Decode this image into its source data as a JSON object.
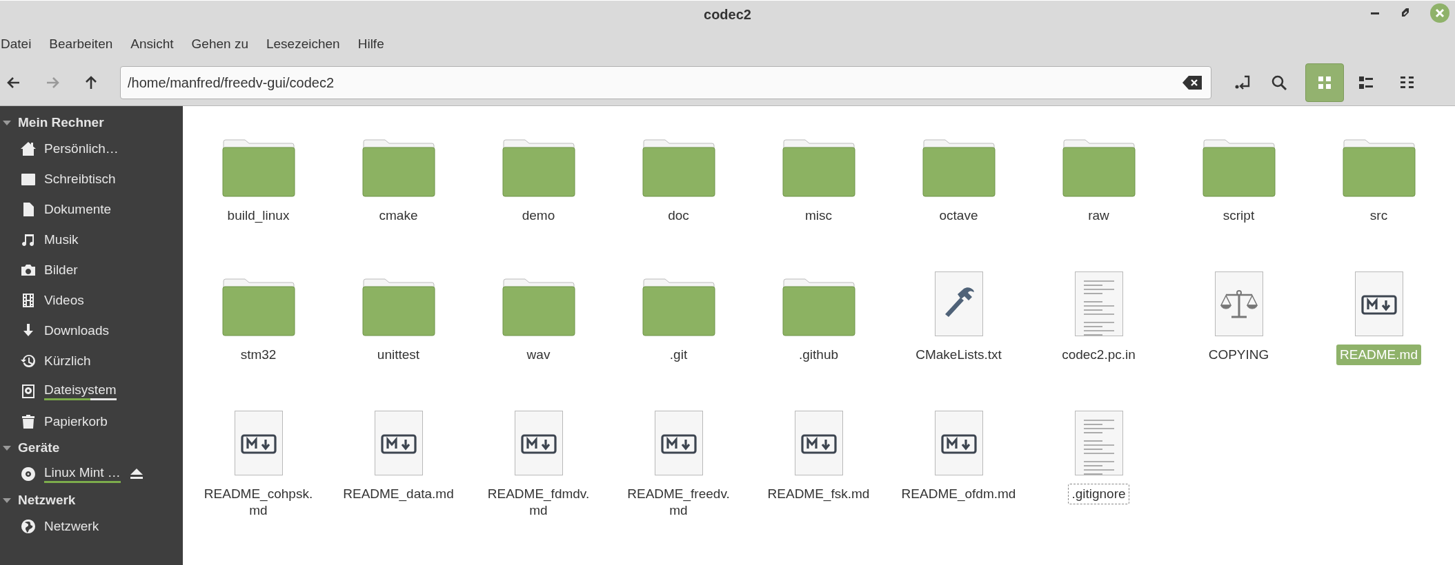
{
  "window": {
    "title": "codec2"
  },
  "menu": [
    "Datei",
    "Bearbeiten",
    "Ansicht",
    "Gehen zu",
    "Lesezeichen",
    "Hilfe"
  ],
  "toolbar": {
    "back": {
      "disabled": false
    },
    "forward": {
      "disabled": true
    },
    "up": {
      "disabled": false
    },
    "location": "/home/manfred/freedv-gui/codec2",
    "views": [
      {
        "kind": "icons",
        "selected": true
      },
      {
        "kind": "compact",
        "selected": false
      },
      {
        "kind": "list",
        "selected": false
      }
    ]
  },
  "sidebar": [
    {
      "title": "Mein Rechner",
      "expanded": true,
      "items": [
        {
          "kind": "home",
          "label": "Persönlich…"
        },
        {
          "kind": "desktop",
          "label": "Schreibtisch"
        },
        {
          "kind": "document",
          "label": "Dokumente"
        },
        {
          "kind": "music",
          "label": "Musik"
        },
        {
          "kind": "camera",
          "label": "Bilder"
        },
        {
          "kind": "film",
          "label": "Videos"
        },
        {
          "kind": "download",
          "label": "Downloads"
        },
        {
          "kind": "history",
          "label": "Kürzlich"
        },
        {
          "kind": "drive",
          "label": "Dateisystem",
          "level": 0.64
        },
        {
          "kind": "trash",
          "label": "Papierkorb"
        }
      ]
    },
    {
      "title": "Geräte",
      "expanded": true,
      "items": [
        {
          "kind": "disc",
          "label": "Linux Mint …",
          "level": 1,
          "eject": true
        }
      ]
    },
    {
      "title": "Netzwerk",
      "expanded": true,
      "items": [
        {
          "kind": "network",
          "label": "Netzwerk"
        }
      ]
    }
  ],
  "files": [
    {
      "kind": "folder",
      "name": "build_linux",
      "selected": false,
      "focused": false
    },
    {
      "kind": "folder",
      "name": "cmake",
      "selected": false,
      "focused": false
    },
    {
      "kind": "folder",
      "name": "demo",
      "selected": false,
      "focused": false
    },
    {
      "kind": "folder",
      "name": "doc",
      "selected": false,
      "focused": false
    },
    {
      "kind": "folder",
      "name": "misc",
      "selected": false,
      "focused": false
    },
    {
      "kind": "folder",
      "name": "octave",
      "selected": false,
      "focused": false
    },
    {
      "kind": "folder",
      "name": "raw",
      "selected": false,
      "focused": false
    },
    {
      "kind": "folder",
      "name": "script",
      "selected": false,
      "focused": false
    },
    {
      "kind": "folder",
      "name": "src",
      "selected": false,
      "focused": false
    },
    {
      "kind": "folder",
      "name": "stm32",
      "selected": false,
      "focused": false
    },
    {
      "kind": "folder",
      "name": "unittest",
      "selected": false,
      "focused": false
    },
    {
      "kind": "folder",
      "name": "wav",
      "selected": false,
      "focused": false
    },
    {
      "kind": "folder",
      "name": ".git",
      "selected": false,
      "focused": false
    },
    {
      "kind": "folder",
      "name": ".github",
      "selected": false,
      "focused": false
    },
    {
      "kind": "cmake",
      "name": "CMakeLists.txt",
      "selected": false,
      "focused": false
    },
    {
      "kind": "text",
      "name": "codec2.pc.in",
      "selected": false,
      "focused": false
    },
    {
      "kind": "license",
      "name": "COPYING",
      "selected": false,
      "focused": false
    },
    {
      "kind": "markdown",
      "name": "README.md",
      "selected": true,
      "focused": false
    },
    {
      "kind": "markdown",
      "name": "README_cohpsk.md",
      "selected": false,
      "focused": false
    },
    {
      "kind": "markdown",
      "name": "README_data.md",
      "selected": false,
      "focused": false
    },
    {
      "kind": "markdown",
      "name": "README_fdmdv.md",
      "selected": false,
      "focused": false
    },
    {
      "kind": "markdown",
      "name": "README_freedv.md",
      "selected": false,
      "focused": false
    },
    {
      "kind": "markdown",
      "name": "README_fsk.md",
      "selected": false,
      "focused": false
    },
    {
      "kind": "markdown",
      "name": "README_ofdm.md",
      "selected": false,
      "focused": false
    },
    {
      "kind": "text",
      "name": ".gitignore",
      "selected": false,
      "focused": true
    }
  ]
}
